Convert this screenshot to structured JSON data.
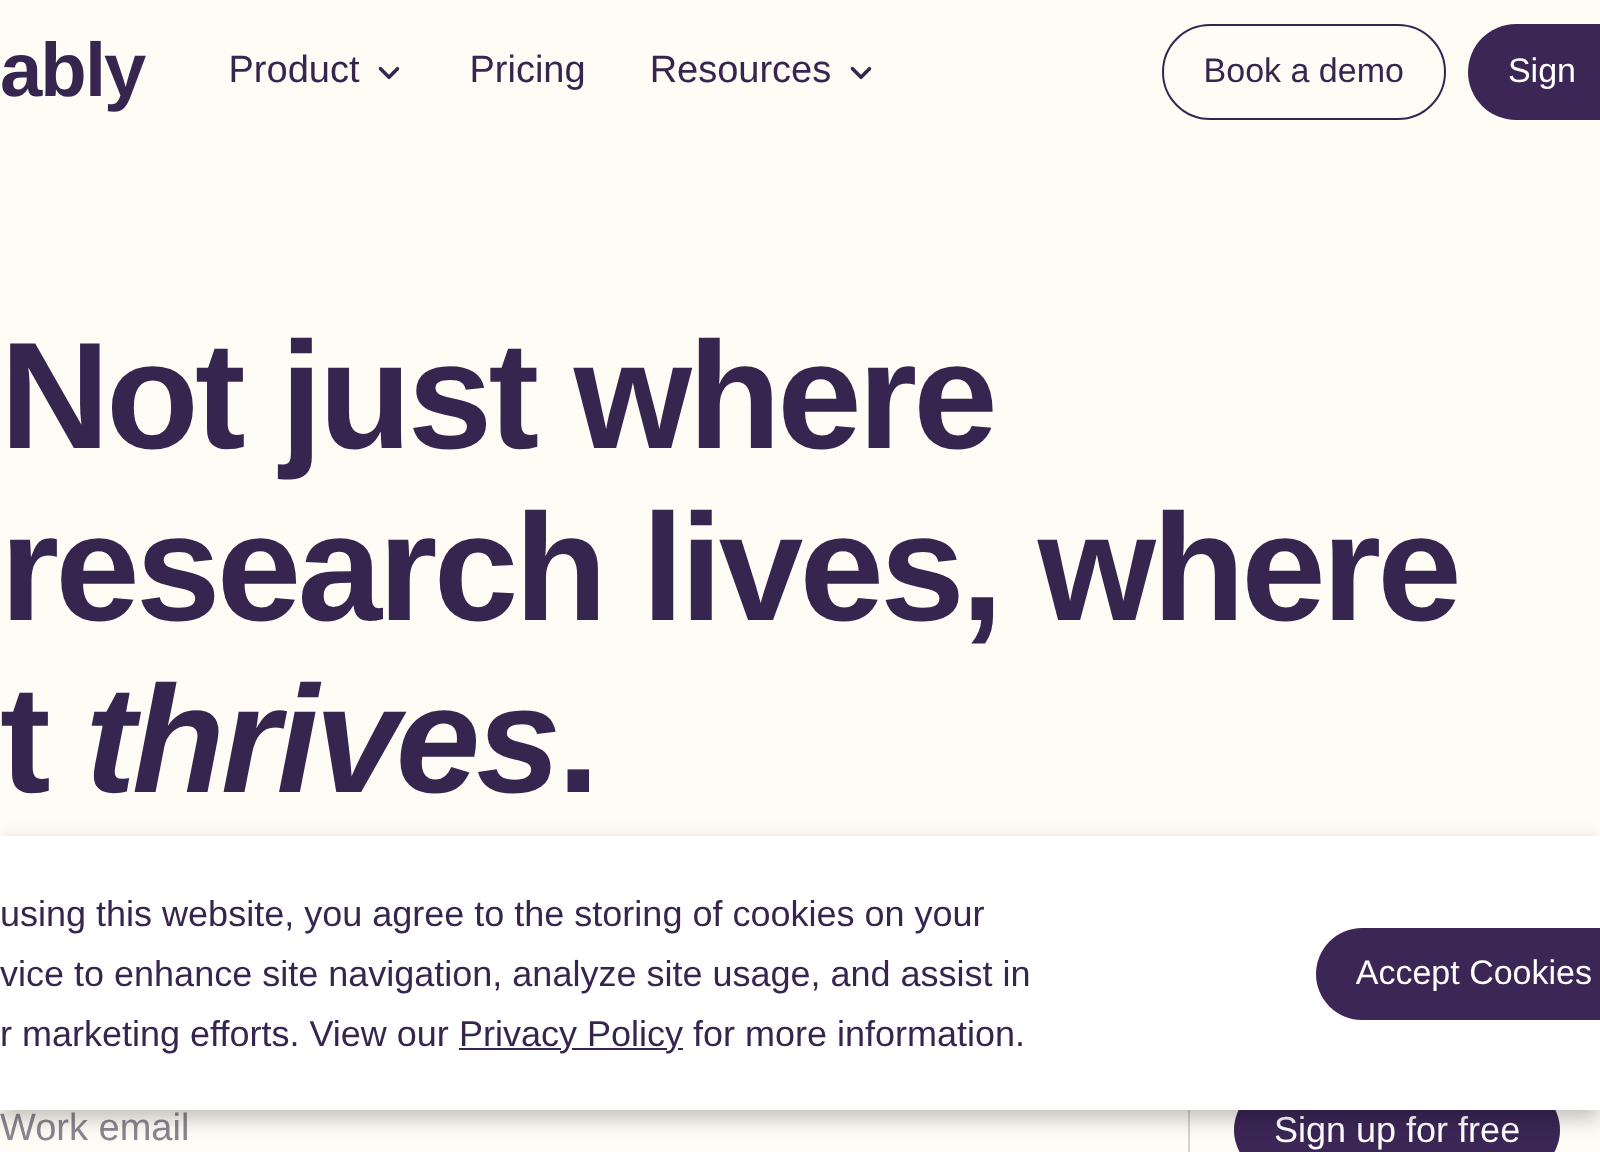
{
  "header": {
    "logo": "ably",
    "nav": [
      {
        "label": "Product",
        "dropdown": true
      },
      {
        "label": "Pricing",
        "dropdown": false
      },
      {
        "label": "Resources",
        "dropdown": true
      }
    ],
    "book_demo": "Book a demo",
    "sign_up": "Sign"
  },
  "hero": {
    "lines": [
      "Not just where",
      "research lives, where",
      "t *thrives*."
    ]
  },
  "signup_form": {
    "placeholder": "Work email",
    "button": "Sign up for free"
  },
  "cookie_banner": {
    "text_before": "using this website, you agree to the storing of cookies on your",
    "text_middle": "vice to enhance site navigation, analyze site usage, and assist in",
    "text_after_start": "r marketing efforts. View our",
    "link": "Privacy Policy",
    "text_after_end": "for more information.",
    "accept": "Accept Cookies"
  }
}
